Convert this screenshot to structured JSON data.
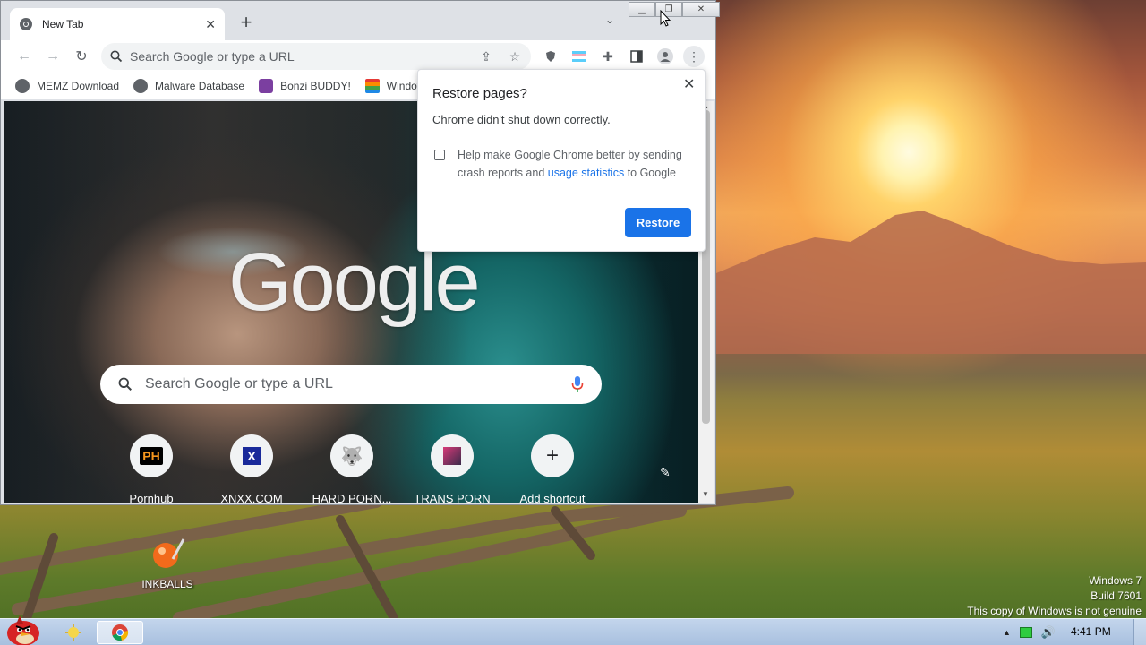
{
  "browser": {
    "tab_title": "New Tab",
    "omnibox_placeholder": "Search Google or type a URL",
    "bookmarks": [
      {
        "label": "MEMZ Download",
        "icon": "globe-icon"
      },
      {
        "label": "Malware Database",
        "icon": "globe-icon"
      },
      {
        "label": "Bonzi BUDDY!",
        "icon": "bonzi-icon"
      },
      {
        "label": "Window",
        "icon": "windows-flag-icon"
      }
    ]
  },
  "ntp": {
    "logo_text": "Google",
    "search_placeholder": "Search Google or type a URL",
    "shortcuts": [
      {
        "label": "Pornhub",
        "icon_text": "PH"
      },
      {
        "label": "XNXX.COM",
        "icon_text": "X"
      },
      {
        "label": "HARD PORN...",
        "icon_text": ""
      },
      {
        "label": "TRANS PORN",
        "icon_text": ""
      },
      {
        "label": "Add shortcut",
        "icon_text": "+"
      }
    ]
  },
  "restore_dialog": {
    "title": "Restore pages?",
    "message": "Chrome didn't shut down correctly.",
    "checkbox_text_before": "Help make Google Chrome better by sending crash reports and ",
    "checkbox_link": "usage statistics",
    "checkbox_text_after": " to Google",
    "button_label": "Restore"
  },
  "desktop": {
    "icon_label": "INKBALLS",
    "watermark_line1": "Windows 7",
    "watermark_line2": "Build 7601",
    "watermark_line3": "This copy of Windows is not genuine"
  },
  "taskbar": {
    "clock": "4:41 PM"
  },
  "colors": {
    "accent": "#1a73e8",
    "taskbar": "#b4c9e4"
  }
}
